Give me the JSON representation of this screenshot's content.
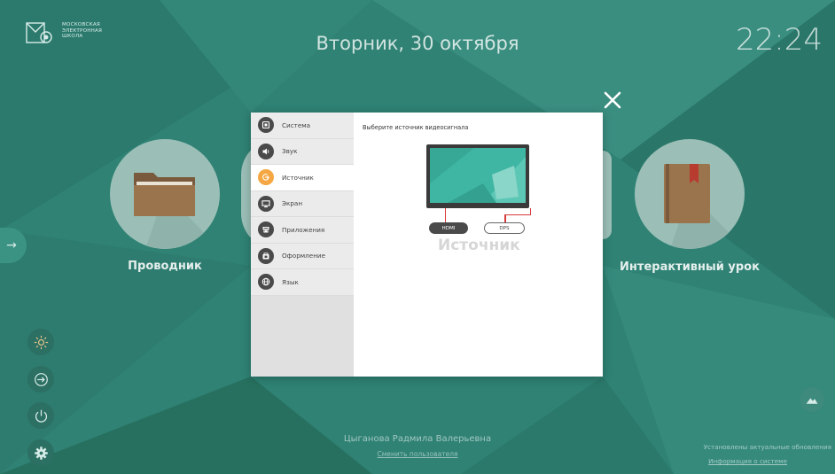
{
  "logo": {
    "lines": [
      "МОСКОВСКАЯ",
      "ЭЛЕКТРОННАЯ",
      "ШКОЛА"
    ]
  },
  "header": {
    "date": "Вторник, 30 октября",
    "time": "22:24"
  },
  "tiles": [
    {
      "label": "Проводник",
      "icon": "folder-icon"
    },
    {
      "label": "Интерактивный урок",
      "icon": "book-icon"
    }
  ],
  "sidebar_buttons": [
    {
      "icon": "brightness-icon"
    },
    {
      "icon": "login-icon"
    },
    {
      "icon": "power-icon"
    },
    {
      "icon": "settings-icon"
    }
  ],
  "settings_dialog": {
    "menu": [
      {
        "label": "Система",
        "icon": "system-icon",
        "active": false
      },
      {
        "label": "Звук",
        "icon": "sound-icon",
        "active": false
      },
      {
        "label": "Источник",
        "icon": "source-icon",
        "active": true
      },
      {
        "label": "Экран",
        "icon": "screen-icon",
        "active": false
      },
      {
        "label": "Приложения",
        "icon": "apps-icon",
        "active": false
      },
      {
        "label": "Оформление",
        "icon": "appearance-icon",
        "active": false
      },
      {
        "label": "Язык",
        "icon": "language-icon",
        "active": false
      }
    ],
    "content_title": "Выберите источник видеосигнала",
    "sources": [
      "HDMI",
      "DPS"
    ],
    "selected_source": "HDMI",
    "caption": "Источник"
  },
  "footer": {
    "user_name": "Цыганова Радмила Валерьевна",
    "change_user": "Сменить пользователя",
    "updates_status": "Установлены актуальные обновления",
    "system_info": "Информация о системе"
  },
  "colors": {
    "background": "#2f8274",
    "accent_active": "#f4a742",
    "tile_circle": "#9bbfb7",
    "screen": "#3fb6a3",
    "connector": "#d83a3a"
  }
}
